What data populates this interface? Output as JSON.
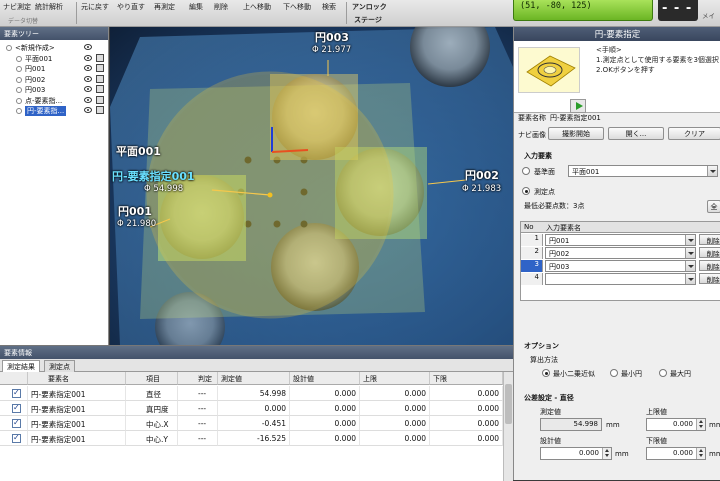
{
  "toolbar": {
    "buttons": [
      {
        "label": "ナビ測定"
      },
      {
        "label": "統計解析"
      },
      {
        "label": "元に戻す"
      },
      {
        "label": "やり直す"
      },
      {
        "label": "再測定"
      },
      {
        "label": "編集"
      },
      {
        "label": "削除"
      },
      {
        "label": "上へ移動"
      },
      {
        "label": "下へ移動"
      },
      {
        "label": "検索"
      },
      {
        "label": "アンロック"
      }
    ],
    "group_left": "データ切替",
    "stage_label": "ステージ",
    "coord_readout": "(51, -80, 125)",
    "digital_display": "- - -",
    "meta_label": "メイ"
  },
  "tree": {
    "title": "要素ツリー",
    "items": [
      {
        "label": "<新規作成>",
        "indent": 0,
        "selected": false,
        "eye": true,
        "box": false
      },
      {
        "label": "平面001",
        "indent": 1,
        "selected": false,
        "eye": true,
        "box": true
      },
      {
        "label": "円001",
        "indent": 1,
        "selected": false,
        "eye": true,
        "box": true
      },
      {
        "label": "円002",
        "indent": 1,
        "selected": false,
        "eye": true,
        "box": true
      },
      {
        "label": "円003",
        "indent": 1,
        "selected": false,
        "eye": true,
        "box": true
      },
      {
        "label": "点-要素指...",
        "indent": 1,
        "selected": false,
        "eye": true,
        "box": true
      },
      {
        "label": "円-要素指...",
        "indent": 1,
        "selected": true,
        "eye": true,
        "box": true
      }
    ]
  },
  "overlay": {
    "labels": [
      {
        "name": "plane001",
        "text": "平面001"
      },
      {
        "name": "circle-spec",
        "text": "円-要素指定001",
        "value": "54.998"
      },
      {
        "name": "circle001",
        "text": "円001",
        "value": "21.980"
      },
      {
        "name": "circle003",
        "text": "円003",
        "value": "21.977"
      },
      {
        "name": "circle002",
        "text": "円002",
        "value": "21.983"
      }
    ],
    "diameter_symbol": "Φ"
  },
  "right_panel": {
    "title": "円-要素指定",
    "help_lines": [
      "<手順>",
      "1.測定点として使用する要素を3個選択",
      "2.OKボタンを押す"
    ],
    "element_name_label": "要素名称",
    "element_name_value": "円-要素指定001",
    "navi_label": "ナビ画像",
    "capture_button": "撮影開始",
    "open_button": "開く...",
    "clear_button": "クリア",
    "input_element_label": "入力要素",
    "ref_plane_label": "基準面",
    "ref_plane_value": "平面001",
    "measure_point_label": "測定点",
    "required_points": "最低必要点数：3点",
    "all_button": "全",
    "table_headers": {
      "no": "No",
      "name": "入力要素名"
    },
    "measure_points": [
      {
        "no": "1",
        "name": "円001",
        "delete": "削除"
      },
      {
        "no": "2",
        "name": "円002",
        "delete": "削除"
      },
      {
        "no": "3",
        "name": "円003",
        "delete": "削除"
      },
      {
        "no": "4",
        "name": "",
        "delete": "削除"
      }
    ],
    "options_label": "オプション",
    "calc_method_label": "算出方法",
    "calc_methods": [
      "最小二乗近似",
      "最小円",
      "最大円"
    ],
    "tolerance_label": "公差設定 - 直径",
    "measured_label": "測定値",
    "measured_value": "54.998",
    "unit_mm": "mm",
    "upper_label": "上限値",
    "upper_value": "0.000",
    "design_label": "設計値",
    "design_value": "0.000",
    "lower_label": "下限値",
    "lower_value": "0.000"
  },
  "info": {
    "title": "要素情報",
    "tabs": [
      "測定結果",
      "測定点"
    ],
    "columns": [
      "要素名",
      "項目",
      "判定",
      "測定値",
      "設計値",
      "上限",
      "下限"
    ],
    "rows": [
      {
        "name": "円-要素指定001",
        "item": "直径",
        "judge": "---",
        "measured": "54.998",
        "design": "0.000",
        "upper": "0.000",
        "lower": "0.000"
      },
      {
        "name": "円-要素指定001",
        "item": "真円度",
        "judge": "---",
        "measured": "0.000",
        "design": "0.000",
        "upper": "0.000",
        "lower": "0.000"
      },
      {
        "name": "円-要素指定001",
        "item": "中心.X",
        "judge": "---",
        "measured": "-0.451",
        "design": "0.000",
        "upper": "0.000",
        "lower": "0.000"
      },
      {
        "name": "円-要素指定001",
        "item": "中心.Y",
        "judge": "---",
        "measured": "-16.525",
        "design": "0.000",
        "upper": "0.000",
        "lower": "0.000"
      }
    ]
  },
  "colors": {
    "accent_green": "#6bb524",
    "selection_blue": "#2f63c7",
    "overlay_yellow": "#f3c020",
    "overlay_green": "#b8e07a"
  }
}
